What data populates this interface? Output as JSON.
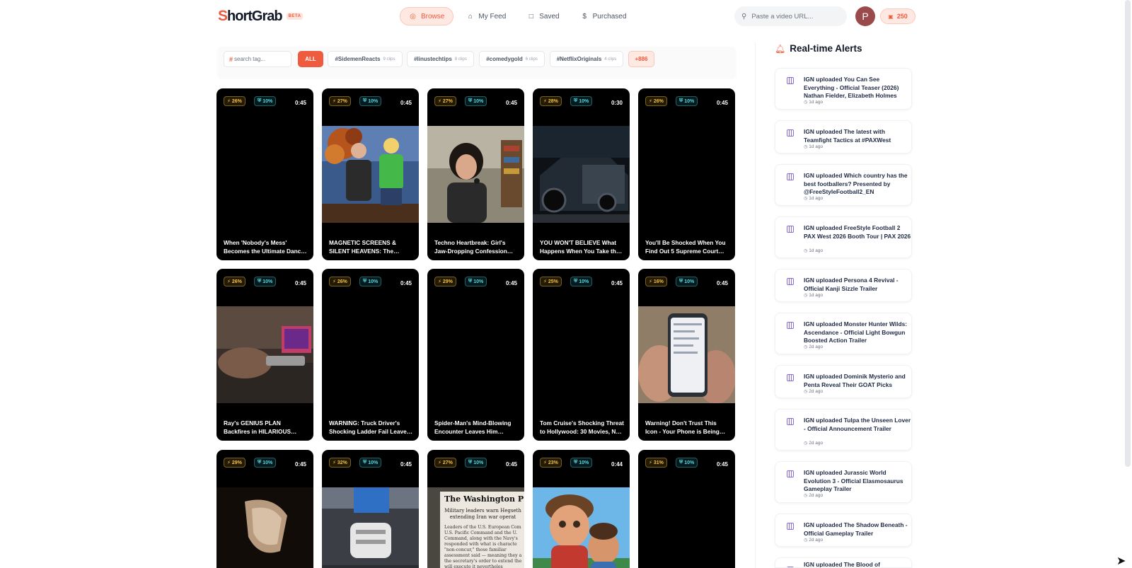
{
  "app": {
    "logo_mark": "S",
    "logo_text": "hortGrab",
    "beta_label": "BETA",
    "search_placeholder": "Paste a video URL...",
    "avatar_initial": "P",
    "credits": "250",
    "accent_color": "#ef5b3f"
  },
  "nav": [
    {
      "label": "Browse",
      "icon": "compass-icon",
      "active": true
    },
    {
      "label": "My Feed",
      "icon": "home-icon",
      "active": false
    },
    {
      "label": "Saved",
      "icon": "bookmark-icon",
      "active": false
    },
    {
      "label": "Purchased",
      "icon": "dollar-icon",
      "active": false
    }
  ],
  "tags": {
    "search_placeholder": "search tag...",
    "all_label": "ALL",
    "chips": [
      {
        "name": "#SidemenReacts",
        "count": "9 clips"
      },
      {
        "name": "#linustechtips",
        "count": "8 clips"
      },
      {
        "name": "#comedygold",
        "count": "6 clips"
      },
      {
        "name": "#NetflixOriginals",
        "count": "4 clips"
      }
    ],
    "more_label": "+886"
  },
  "clips": [
    {
      "viral": "26%",
      "shield": "10%",
      "duration": "0:45",
      "title": "When 'Nobody's Mess' Becomes the Ultimate Dance Craze",
      "thumb": "none"
    },
    {
      "viral": "27%",
      "shield": "10%",
      "duration": "0:45",
      "title": "MAGNETIC SCREENS & SILENT HEAVENS: The Weirdest Tech Showdown",
      "thumb": "studio"
    },
    {
      "viral": "27%",
      "shield": "10%",
      "duration": "0:45",
      "title": "Techno Heartbreak: Girl's Jaw-Dropping Confession Stuns Everyone",
      "thumb": "girl"
    },
    {
      "viral": "28%",
      "shield": "10%",
      "duration": "0:30",
      "title": "YOU WON'T BELIEVE What Happens When You Take the Wrong Car",
      "thumb": "car"
    },
    {
      "viral": "26%",
      "shield": "10%",
      "duration": "0:45",
      "title": "You'll Be Shocked When You Find Out 5 Supreme Court Secrets",
      "thumb": "none"
    },
    {
      "viral": "26%",
      "shield": "10%",
      "duration": "0:45",
      "title": "Ray's GENIUS PLAN Backfires in HILARIOUS Fashion",
      "thumb": "desk"
    },
    {
      "viral": "26%",
      "shield": "10%",
      "duration": "0:45",
      "title": "WARNING: Truck Driver's Shocking Ladder Fail Leaves Everyone Stunned",
      "thumb": "none"
    },
    {
      "viral": "29%",
      "shield": "10%",
      "duration": "0:45",
      "title": "Spider-Man's Mind-Blowing Encounter Leaves Him Speechless",
      "thumb": "none"
    },
    {
      "viral": "25%",
      "shield": "10%",
      "duration": "0:45",
      "title": "Tom Cruise's Shocking Threat to Hollywood: 30 Movies, No Limits",
      "thumb": "none"
    },
    {
      "viral": "16%",
      "shield": "10%",
      "duration": "0:45",
      "title": "Warning! Don't Trust This Icon - Your Phone is Being Tracked",
      "thumb": "phone"
    },
    {
      "viral": "29%",
      "shield": "10%",
      "duration": "0:45",
      "title": "",
      "thumb": "hand"
    },
    {
      "viral": "32%",
      "shield": "10%",
      "duration": "0:45",
      "title": "",
      "thumb": "shoes"
    },
    {
      "viral": "27%",
      "shield": "10%",
      "duration": "0:45",
      "title": "",
      "thumb": "newspaper"
    },
    {
      "viral": "23%",
      "shield": "10%",
      "duration": "0:44",
      "title": "",
      "thumb": "cartoon"
    },
    {
      "viral": "31%",
      "shield": "10%",
      "duration": "0:45",
      "title": "",
      "thumb": "none"
    }
  ],
  "thumb_text": {
    "newspaper_masthead": "The Washington P",
    "newspaper_headline": "Military leaders warn Hegseth extending Iran war operat",
    "newspaper_body": "Leaders of the U.S. European Com U.S. Pacific Command and the U. Command, along with the Navy's responded with what is characte \"non-concur,\" those familiar assessment said — meaning they a the secretary's order to extend the will execute it nevertheles"
  },
  "alerts": {
    "title": "Real-time Alerts",
    "items": [
      {
        "text": "IGN uploaded You Can See Everything - Official Teaser (2026) Nathan Fielder, Elizabeth Holmes",
        "time": "1d ago"
      },
      {
        "text": "IGN uploaded The latest with Teamfight Tactics at #PAXWest",
        "time": "1d ago"
      },
      {
        "text": "IGN uploaded Which country has the best footballers? Presented by @FreeStyleFootball2_EN",
        "time": "1d ago"
      },
      {
        "text": "IGN uploaded FreeStyle Football 2 PAX West 2026 Booth Tour | PAX 2026",
        "time": "1d ago"
      },
      {
        "text": "IGN uploaded Persona 4 Revival - Official Kanji Sizzle Trailer",
        "time": "1d ago"
      },
      {
        "text": "IGN uploaded Monster Hunter Wilds: Ascendance - Official Light Bowgun Boosted Action Trailer",
        "time": "2d ago"
      },
      {
        "text": "IGN uploaded Dominik Mysterio and Penta Reveal Their GOAT Picks",
        "time": "2d ago"
      },
      {
        "text": "IGN uploaded Tulpa the Unseen Lover - Official Announcement Trailer",
        "time": "2d ago"
      },
      {
        "text": "IGN uploaded Jurassic World Evolution 3 - Official Elasmosaurus Gameplay Trailer",
        "time": "2d ago"
      },
      {
        "text": "IGN uploaded The Shadow Beneath - Official Gameplay Trailer",
        "time": "2d ago"
      },
      {
        "text": "IGN uploaded The Blood of",
        "time": ""
      }
    ]
  }
}
